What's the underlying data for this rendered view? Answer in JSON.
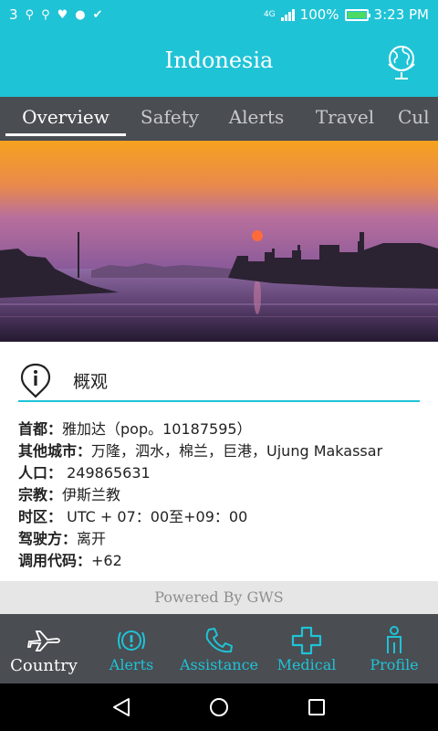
{
  "status_bar": {
    "notification_count": "3",
    "network": "4G",
    "battery": "100%",
    "battery_level": 1.0,
    "time": "3:23 PM"
  },
  "header": {
    "title": "Indonesia",
    "globe_icon": "globe-icon"
  },
  "tabs": [
    {
      "label": "Overview",
      "active": true
    },
    {
      "label": "Safety",
      "active": false
    },
    {
      "label": "Alerts",
      "active": false
    },
    {
      "label": "Travel",
      "active": false
    },
    {
      "label": "Cul",
      "active": false
    }
  ],
  "overview": {
    "title": "概观",
    "icon": "info-pin-icon",
    "rows": [
      {
        "key": "首都：",
        "value": "雅加达（pop。10187595）"
      },
      {
        "key": "其他城市：",
        "value": "万隆，泗水，棉兰，巨港，Ujung Makassar"
      },
      {
        "key": "人口：",
        "value": " 249865631"
      },
      {
        "key": "宗教：",
        "value": "伊斯兰教"
      },
      {
        "key": "时区：",
        "value": " UTC + 07：00至+09：00"
      },
      {
        "key": "驾驶方：",
        "value": "离开"
      },
      {
        "key": "调用代码：",
        "value": "+62"
      }
    ]
  },
  "footer": {
    "powered_by": "Powered By GWS"
  },
  "bottom_nav": [
    {
      "label": "Country",
      "icon": "plane-icon",
      "active": true
    },
    {
      "label": "Alerts",
      "icon": "alert-badge-icon",
      "active": false
    },
    {
      "label": "Assistance",
      "icon": "phone-icon",
      "active": false
    },
    {
      "label": "Medical",
      "icon": "medical-cross-icon",
      "active": false
    },
    {
      "label": "Profile",
      "icon": "person-icon",
      "active": false
    }
  ],
  "colors": {
    "accent": "#1fc3d6",
    "dark_bar": "#4a4d52",
    "footer_bg": "#e6e6e6"
  }
}
